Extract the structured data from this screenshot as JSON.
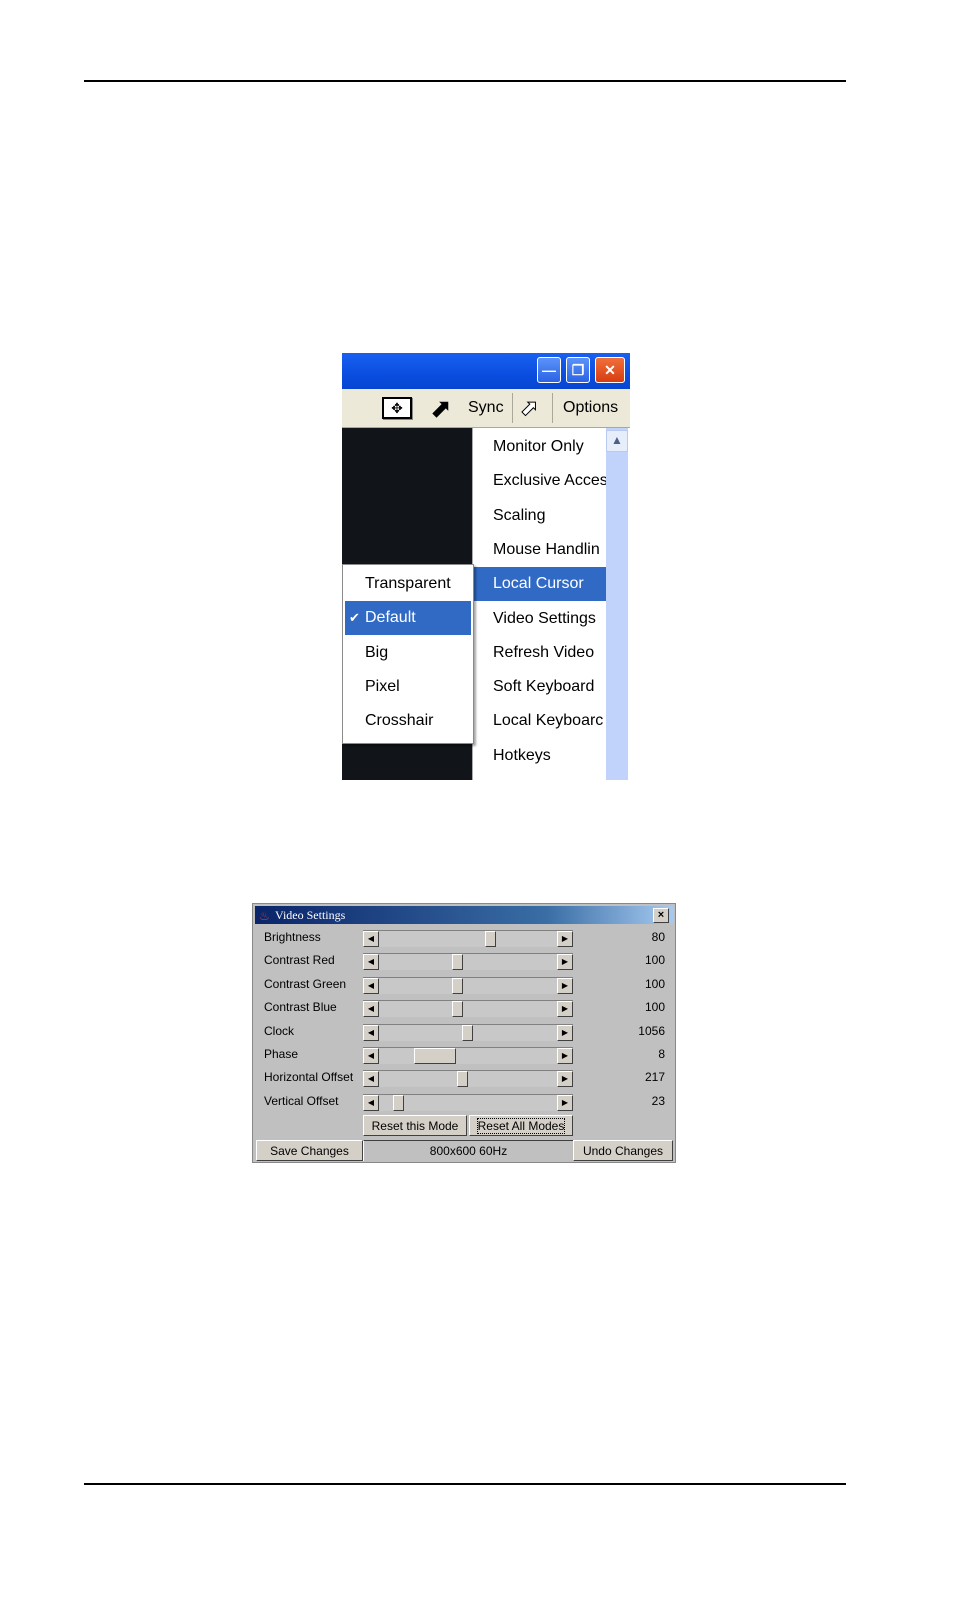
{
  "kvm_window": {
    "toolbar": {
      "fit_icon": "fit-screen-icon",
      "sync_label": "Sync",
      "options_label": "Options"
    },
    "options_menu": [
      {
        "label": "Monitor Only",
        "selected": false
      },
      {
        "label": "Exclusive Acces",
        "selected": false
      },
      {
        "label": "Scaling",
        "selected": false
      },
      {
        "label": "Mouse Handlin",
        "selected": false
      },
      {
        "label": "Local Cursor",
        "selected": true
      },
      {
        "label": "Video Settings",
        "selected": false
      },
      {
        "label": "Refresh Video",
        "selected": false
      },
      {
        "label": "Soft Keyboard",
        "selected": false
      },
      {
        "label": "Local Keyboarc",
        "selected": false
      },
      {
        "label": "Hotkeys",
        "selected": false
      }
    ],
    "cursor_submenu": [
      {
        "label": "Transparent",
        "checked": false
      },
      {
        "label": "Default",
        "checked": true
      },
      {
        "label": "Big",
        "checked": false
      },
      {
        "label": "Pixel",
        "checked": false
      },
      {
        "label": "Crosshair",
        "checked": false
      }
    ],
    "colors": {
      "selection": "#316ac5",
      "titlebar": "#0a4ee0"
    }
  },
  "video_settings": {
    "title": "Video Settings",
    "sliders": [
      {
        "label": "Brightness",
        "value": "80",
        "position": 0.63
      },
      {
        "label": "Contrast Red",
        "value": "100",
        "position": 0.43
      },
      {
        "label": "Contrast Green",
        "value": "100",
        "position": 0.43
      },
      {
        "label": "Contrast Blue",
        "value": "100",
        "position": 0.43
      },
      {
        "label": "Clock",
        "value": "1056",
        "position": 0.49
      },
      {
        "label": "Phase",
        "value": "8",
        "position": 0.25
      },
      {
        "label": "Horizontal Offset",
        "value": "217",
        "position": 0.46
      },
      {
        "label": "Vertical Offset",
        "value": "23",
        "position": 0.08
      }
    ],
    "reset_mode_label": "Reset this Mode",
    "reset_all_label": "Reset All Modes",
    "save_label": "Save Changes",
    "mode_text": "800x600 60Hz",
    "undo_label": "Undo Changes"
  }
}
